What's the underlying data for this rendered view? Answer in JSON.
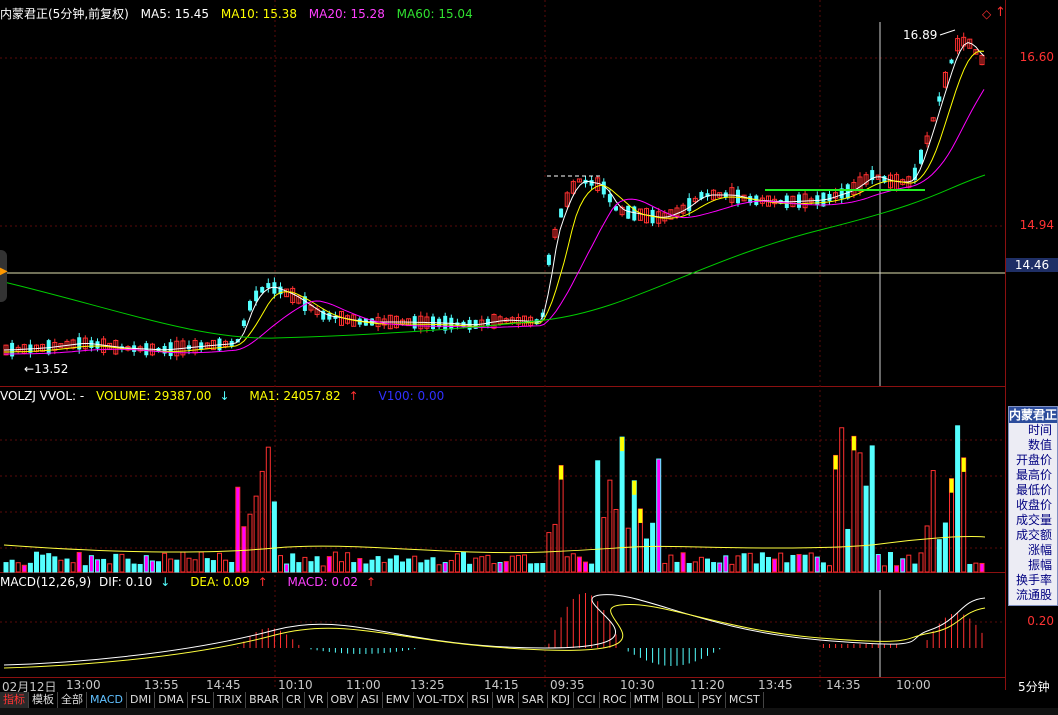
{
  "header": {
    "title": "内蒙君正(5分钟,前复权)",
    "ma5": "MA5: 15.45",
    "ma10": "MA10: 15.38",
    "ma20": "MA20: 15.28",
    "ma60": "MA60: 15.04",
    "diamond": "◇"
  },
  "price_axis": {
    "labels": [
      "16.60",
      "14.94"
    ],
    "current": "14.46"
  },
  "annotations": {
    "high": "16.89",
    "low": "13.52"
  },
  "volume": {
    "label": "VOLZJ VVOL: -",
    "vol": "VOLUME: 29387.00",
    "ma1": "MA1: 24057.82",
    "v100": "V100: 0.00"
  },
  "macd": {
    "label": "MACD(12,26,9)",
    "dif": "DIF: 0.10",
    "dea": "DEA: 0.09",
    "macd": "MACD: 0.02",
    "axis": "0.20"
  },
  "info_panel": {
    "title": "内蒙君正",
    "items": [
      "时间",
      "数值",
      "开盘价",
      "最高价",
      "最低价",
      "收盘价",
      "成交量",
      "成交额",
      "涨幅",
      "振幅",
      "换手率",
      "流通股"
    ]
  },
  "time_axis": {
    "labels": [
      "02月12日",
      "13:00",
      "13:55",
      "14:45",
      "10:10",
      "11:00",
      "13:25",
      "14:15",
      "09:35",
      "10:30",
      "11:20",
      "13:45",
      "14:35",
      "10:00"
    ],
    "right": "5分钟"
  },
  "tabs": [
    "指标",
    "模板",
    "全部",
    "MACD",
    "DMI",
    "DMA",
    "FSL",
    "TRIX",
    "BRAR",
    "CR",
    "VR",
    "OBV",
    "ASI",
    "EMV",
    "VOL-TDX",
    "RSI",
    "WR",
    "SAR",
    "KDJ",
    "CCI",
    "ROC",
    "MTM",
    "BOLL",
    "PSY",
    "MCST"
  ],
  "colors": {
    "up": "#ff3030",
    "down": "#54ffff",
    "ma5": "#ffffff",
    "ma10": "#ffff00",
    "ma20": "#ff00ff",
    "ma60": "#00cc00",
    "grid": "#8b1010"
  }
}
